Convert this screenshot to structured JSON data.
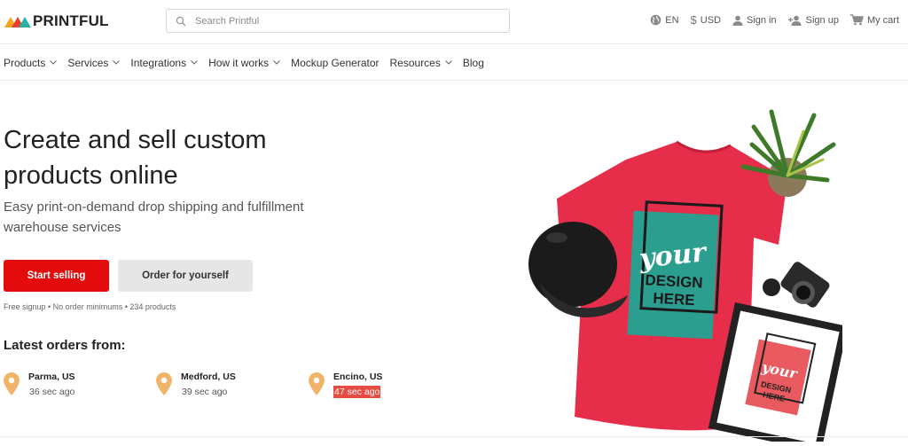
{
  "brand": {
    "name": "PRINTFUL"
  },
  "search": {
    "placeholder": "Search Printful"
  },
  "header_links": {
    "language": "EN",
    "currency": "USD",
    "sign_in": "Sign in",
    "sign_up": "Sign up",
    "cart": "My cart"
  },
  "nav": {
    "items": [
      {
        "label": "Products",
        "has_dropdown": true
      },
      {
        "label": "Services",
        "has_dropdown": true
      },
      {
        "label": "Integrations",
        "has_dropdown": true
      },
      {
        "label": "How it works",
        "has_dropdown": true
      },
      {
        "label": "Mockup Generator",
        "has_dropdown": false
      },
      {
        "label": "Resources",
        "has_dropdown": true
      },
      {
        "label": "Blog",
        "has_dropdown": false
      }
    ]
  },
  "hero": {
    "title_line1": "Create and sell custom",
    "title_line2": "products online",
    "subtitle_line1": "Easy print-on-demand drop shipping and fulfillment",
    "subtitle_line2": "warehouse services",
    "primary_cta": "Start selling",
    "secondary_cta": "Order for yourself",
    "fine_print": "Free signup • No order minimums • 234 products",
    "image_text": {
      "line1": "your",
      "line2": "DESIGN",
      "line3": "HERE"
    }
  },
  "latest_orders": {
    "title": "Latest orders from:",
    "items": [
      {
        "city": "Parma, US",
        "ago": "36 sec ago",
        "highlighted": false
      },
      {
        "city": "Medford, US",
        "ago": "39 sec ago",
        "highlighted": false
      },
      {
        "city": "Encino, US",
        "ago": "47 sec ago",
        "highlighted": true
      }
    ]
  },
  "colors": {
    "accent_red": "#e30b0b",
    "secondary_button": "#e6e6e6",
    "pin_orange": "#f0b469",
    "highlight": "#e84b42",
    "tshirt_red": "#e62d4a",
    "design_teal": "#2c9e90"
  },
  "icons": [
    "logo-mark-icon",
    "search-icon",
    "globe-icon",
    "dollar-icon",
    "user-icon",
    "add-user-icon",
    "cart-icon",
    "chevron-down-icon",
    "map-pin-icon"
  ]
}
